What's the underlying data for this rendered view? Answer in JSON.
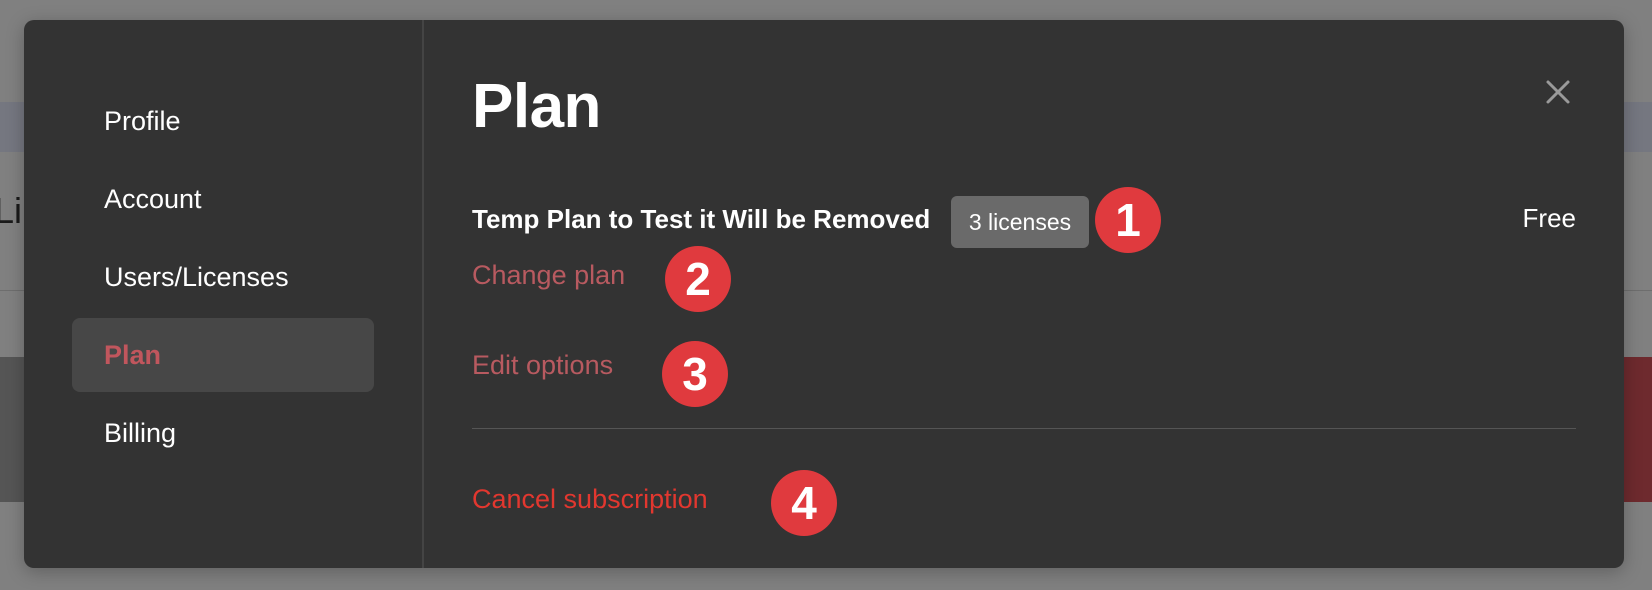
{
  "background": {
    "fragment_text": "Li"
  },
  "sidebar": {
    "items": [
      {
        "label": "Profile"
      },
      {
        "label": "Account"
      },
      {
        "label": "Users/Licenses"
      },
      {
        "label": "Plan"
      },
      {
        "label": "Billing"
      }
    ],
    "active_item": "Plan"
  },
  "main": {
    "title": "Plan",
    "close_icon": "close-icon",
    "plan_name": "Temp Plan to Test it Will be Removed",
    "license_badge": "3 licenses",
    "price": "Free",
    "change_plan_label": "Change plan",
    "edit_options_label": "Edit options",
    "cancel_subscription_label": "Cancel subscription"
  },
  "annotations": {
    "markers": [
      "1",
      "2",
      "3",
      "4"
    ]
  },
  "colors": {
    "modal_bg": "#333333",
    "active_nav_bg": "#474747",
    "accent_muted": "#b85a60",
    "danger": "#e2372f",
    "marker": "#e03a3e"
  }
}
